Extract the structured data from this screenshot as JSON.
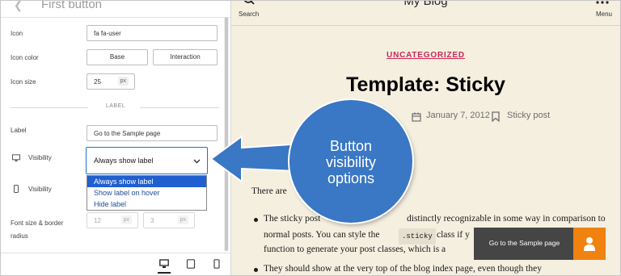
{
  "panel": {
    "title": "First button",
    "icon_label": "Icon",
    "icon_value": "fa fa-user",
    "icon_color_label": "Icon color",
    "icon_color_options": [
      "Base",
      "Interaction"
    ],
    "icon_size_label": "Icon size",
    "icon_size_value": "25",
    "icon_size_unit": "px",
    "section_label": "LABEL",
    "label_label": "Label",
    "label_value": "Go to the Sample page",
    "visibility_label": "Visibility",
    "visibility_selected": "Always show label",
    "visibility_options": [
      "Always show label",
      "Show label on hover",
      "Hide label"
    ],
    "visibility_mobile_label": "Visibility",
    "font_size_label_line1": "Font size & border",
    "font_size_label_line2": "radius",
    "font_size_value": "12",
    "font_size_unit": "px",
    "radius_value": "3",
    "radius_unit": "px"
  },
  "preview": {
    "search_label": "Search",
    "blog_title": "My Blog",
    "menu_label": "Menu",
    "category": "UNCATEGORIZED",
    "post_title": "Template: Sticky",
    "date": "January 7, 2012",
    "sticky": "Sticky post",
    "para_fragment": "There are",
    "bullet1_line1_a": "The sticky post",
    "bullet1_line1_b": "distinctly recognizable in some way in comparison to",
    "bullet1_line2_a": "normal posts. You can style the",
    "bullet1_code": ".sticky",
    "bullet1_line2_b": "class if y",
    "bullet1_line3": "function to generate your post classes, which is a",
    "bullet2_line1": "They should show at the very top of the blog index page, even though they",
    "sample_button_label": "Go to the Sample page"
  },
  "callout": {
    "lines": [
      "Button",
      "visibility",
      "options"
    ]
  },
  "colors": {
    "accent_blue": "#3a77c4",
    "select_blue": "#1f5fd0",
    "category_red": "#cd2653",
    "button_orange": "#f0820f",
    "preview_bg": "#f5efe0"
  },
  "icons": [
    "search-icon",
    "menu-dots-icon",
    "calendar-icon",
    "bookmark-icon",
    "desktop-icon",
    "tablet-icon",
    "mobile-icon",
    "user-icon",
    "chevron-down-icon"
  ]
}
